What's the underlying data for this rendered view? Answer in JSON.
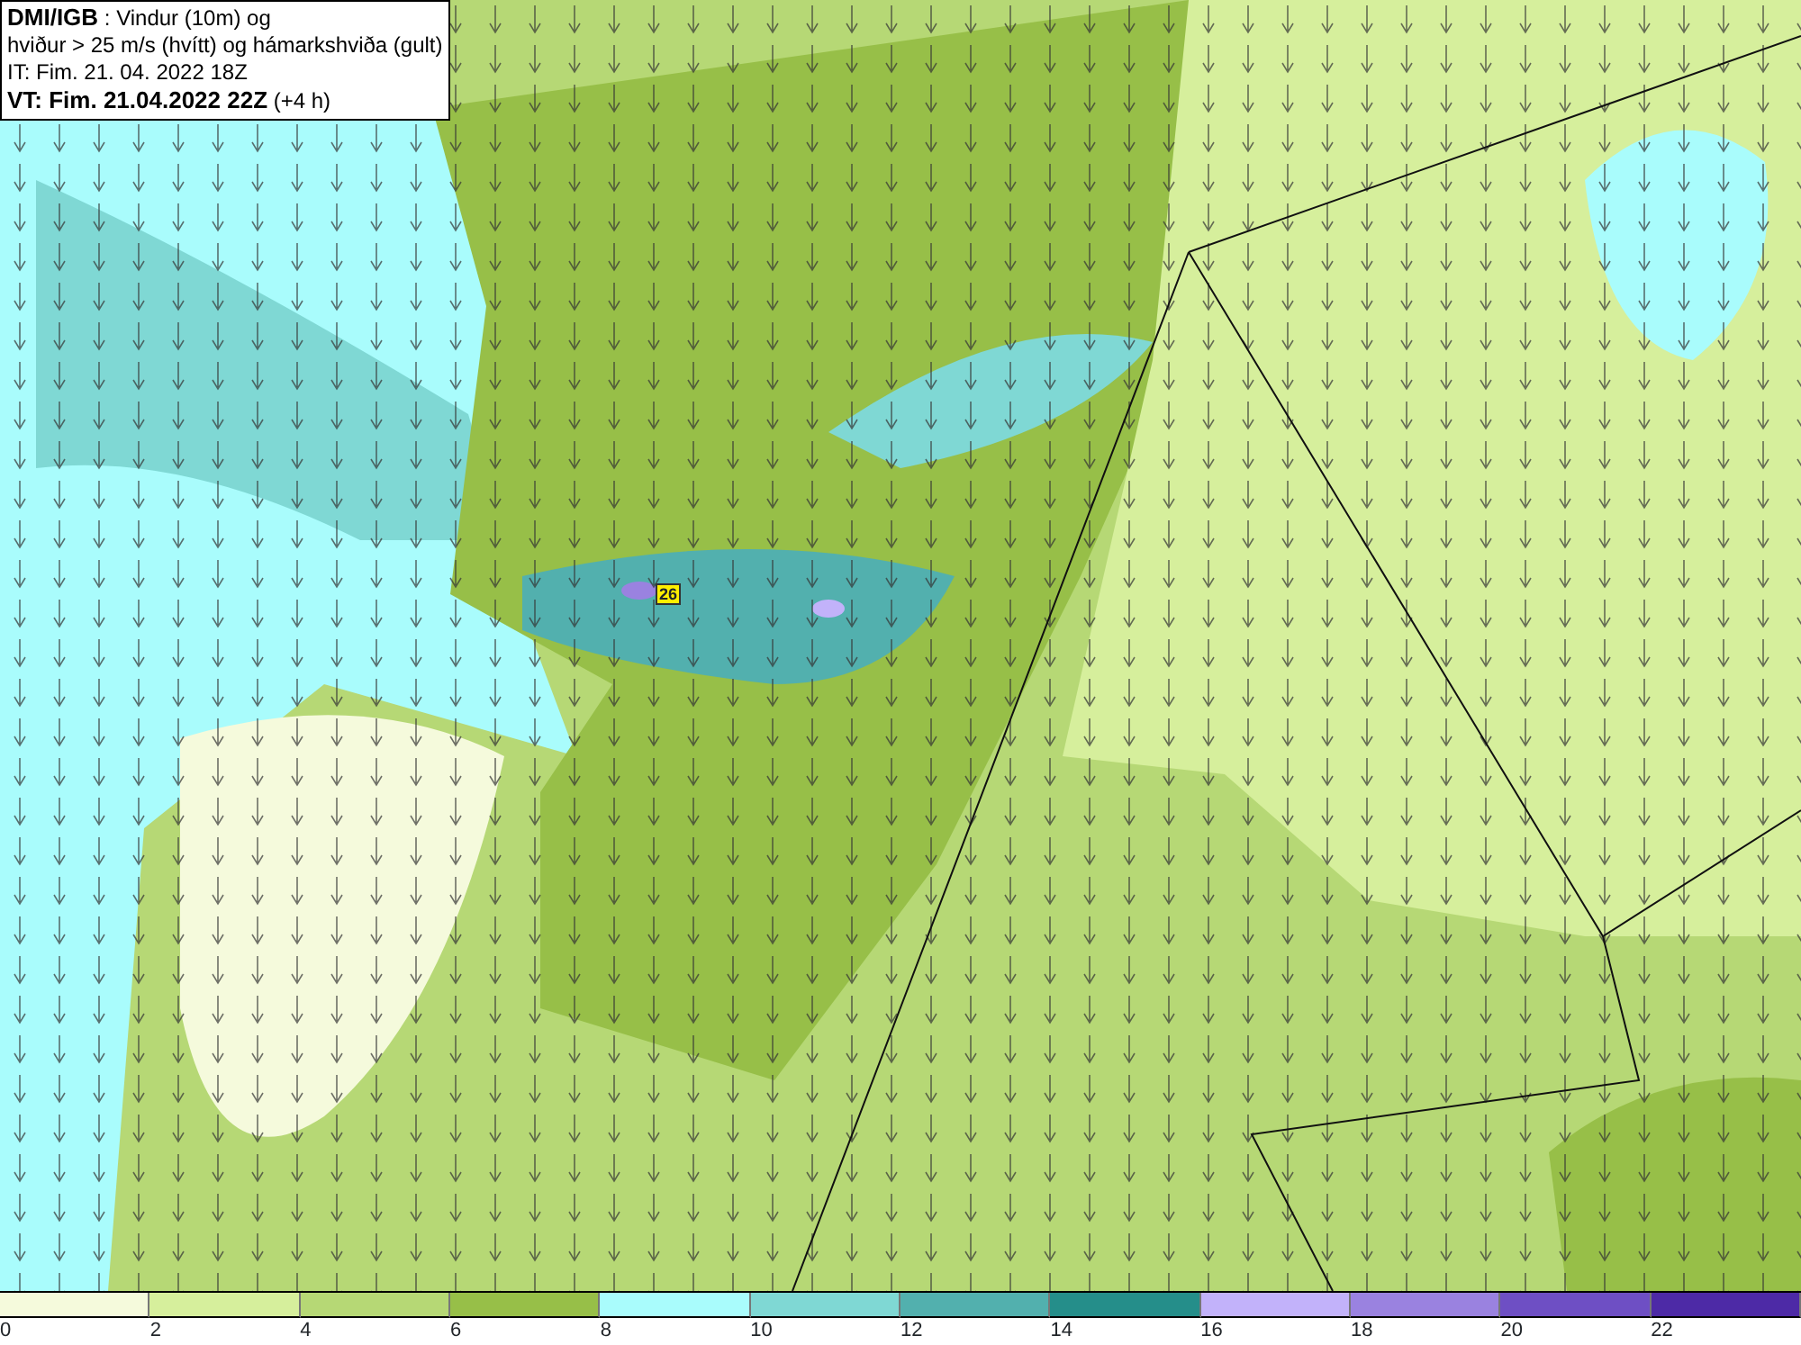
{
  "header": {
    "lines": [
      "**DMI/IGB** : Vindur (10m) og",
      "hviður > 25 m/s (hvítt) og hámarkshviða (gult)",
      "IT: Fim. 21. 04. 2022 18Z",
      "**VT: Fim. 21.04.2022 22Z** (+4 h)"
    ]
  },
  "map": {
    "max_gust": "26"
  },
  "legend": [
    {
      "label": "0",
      "color": "#f5fadc"
    },
    {
      "label": "2",
      "color": "#d6ef9c"
    },
    {
      "label": "4",
      "color": "#b6d875"
    },
    {
      "label": "6",
      "color": "#97bf48"
    },
    {
      "label": "8",
      "color": "#a9fcfc"
    },
    {
      "label": "10",
      "color": "#7fd8d4"
    },
    {
      "label": "12",
      "color": "#52b0ae"
    },
    {
      "label": "14",
      "color": "#258e8a"
    },
    {
      "label": "16",
      "color": "#c2b2fa"
    },
    {
      "label": "18",
      "color": "#9a82e0"
    },
    {
      "label": "20",
      "color": "#6e4fc4"
    },
    {
      "label": "22",
      "color": "#4d2aa6"
    }
  ]
}
